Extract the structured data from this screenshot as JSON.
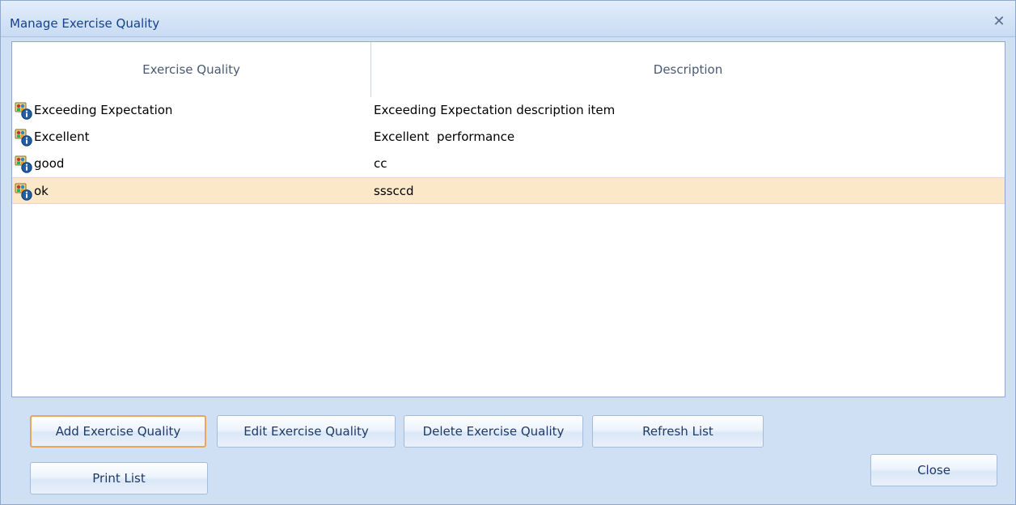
{
  "window": {
    "title": "Manage Exercise Quality",
    "close_glyph": "✕"
  },
  "grid": {
    "columns": [
      "Exercise Quality",
      "Description"
    ],
    "rows": [
      {
        "quality": "Exceeding Expectation",
        "description": "Exceeding Expectation description item",
        "icon": "exercise-info-icon",
        "selected": false
      },
      {
        "quality": "Excellent",
        "description": "Excellent  performance",
        "icon": "exercise-info-icon",
        "selected": false
      },
      {
        "quality": "good",
        "description": "cc",
        "icon": "exercise-info-icon",
        "selected": false
      },
      {
        "quality": "ok",
        "description": "sssccd",
        "icon": "exercise-info-icon",
        "selected": true
      }
    ]
  },
  "buttons": {
    "add": "Add Exercise Quality",
    "edit": "Edit Exercise Quality",
    "delete": "Delete Exercise Quality",
    "refresh": "Refresh List",
    "print": "Print List",
    "close": "Close"
  },
  "colors": {
    "title_text": "#15428b",
    "selected_row": "#fbe8c8",
    "default_button_border": "#e9a65a",
    "panel_background": "#cfe0f5"
  }
}
